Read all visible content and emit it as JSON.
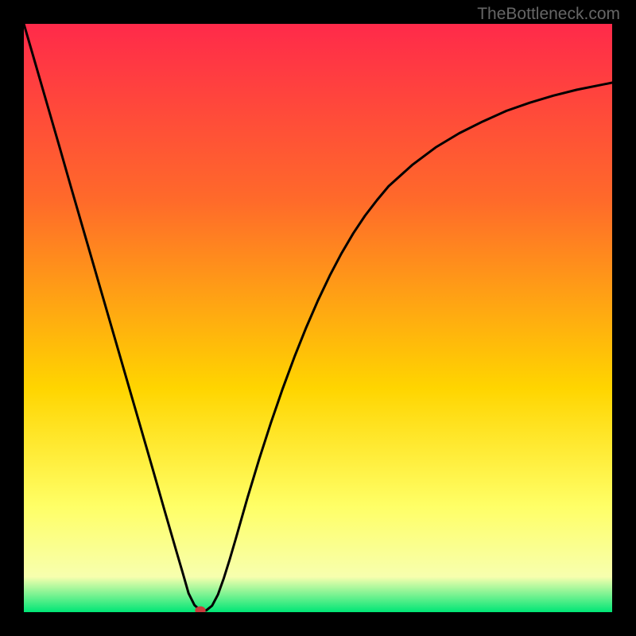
{
  "watermark": "TheBottleneck.com",
  "colors": {
    "bg_black": "#000000",
    "marker": "#c93c3c",
    "curve": "#000000",
    "grad_top": "#ff2a4a",
    "grad_mid1": "#ff6a2a",
    "grad_mid2": "#ffd500",
    "grad_low1": "#ffff66",
    "grad_low2": "#f7ffae",
    "grad_bottom": "#00e676"
  },
  "chart_data": {
    "type": "line",
    "title": "",
    "xlabel": "",
    "ylabel": "",
    "xlim": [
      0,
      100
    ],
    "ylim": [
      0,
      100
    ],
    "x": [
      0,
      2,
      4,
      6,
      8,
      10,
      12,
      14,
      16,
      18,
      20,
      22,
      24,
      26,
      27,
      28,
      29,
      30,
      31,
      32,
      33,
      34,
      35,
      36,
      38,
      40,
      42,
      44,
      46,
      48,
      50,
      52,
      54,
      56,
      58,
      60,
      62,
      66,
      70,
      74,
      78,
      82,
      86,
      90,
      94,
      98,
      100
    ],
    "y": [
      100,
      93.1,
      86.2,
      79.3,
      72.3,
      65.4,
      58.5,
      51.6,
      44.7,
      37.8,
      30.9,
      24.0,
      17.0,
      10.1,
      6.7,
      3.2,
      1.2,
      0.3,
      0.3,
      1.1,
      3.0,
      5.8,
      9.0,
      12.4,
      19.4,
      26.0,
      32.2,
      38.0,
      43.4,
      48.4,
      53.0,
      57.2,
      61.0,
      64.4,
      67.4,
      70.0,
      72.4,
      76.0,
      79.0,
      81.4,
      83.4,
      85.2,
      86.6,
      87.8,
      88.8,
      89.6,
      90.0
    ],
    "marker": {
      "x": 30,
      "y": 0.3,
      "rx": 0.9,
      "ry": 0.7
    },
    "annotations": []
  }
}
